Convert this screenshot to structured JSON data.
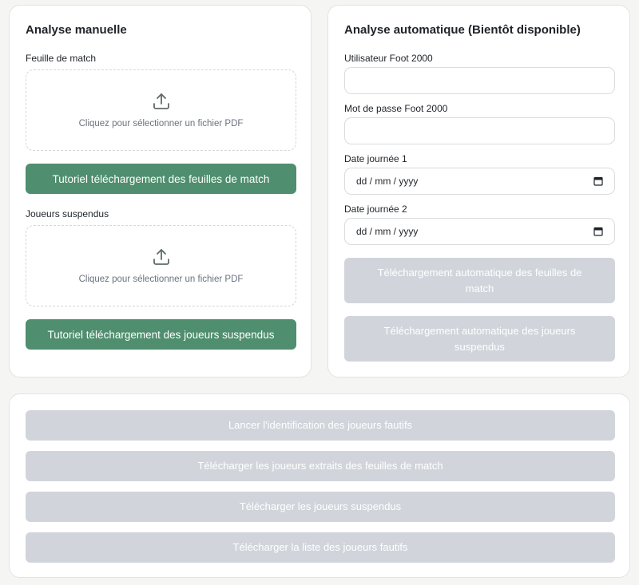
{
  "manual": {
    "title": "Analyse manuelle",
    "match_sheet_label": "Feuille de match",
    "match_sheet_dropzone_text": "Cliquez pour sélectionner un fichier PDF",
    "match_sheet_tutorial_button": "Tutoriel téléchargement des feuilles de match",
    "suspended_label": "Joueurs suspendus",
    "suspended_dropzone_text": "Cliquez pour sélectionner un fichier PDF",
    "suspended_tutorial_button": "Tutoriel téléchargement des joueurs suspendus",
    "icon": "upload-icon"
  },
  "auto": {
    "title": "Analyse automatique (Bientôt disponible)",
    "user_label": "Utilisateur Foot 2000",
    "user_value": "",
    "password_label": "Mot de passe Foot 2000",
    "password_value": "",
    "date1_label": "Date journée 1",
    "date1_placeholder": "dd / mm / yyyy",
    "date2_label": "Date journée 2",
    "date2_placeholder": "dd / mm / yyyy",
    "download_sheets_button": "Téléchargement automatique des feuilles de match",
    "download_suspended_button": "Téléchargement automatique des joueurs suspendus",
    "calendar_icon": "calendar-icon"
  },
  "actions": {
    "identify_button": "Lancer l'identification des joueurs fautifs",
    "download_extracted_button": "Télécharger les joueurs extraits des feuilles de match",
    "download_suspended_button": "Télécharger les joueurs suspendus",
    "download_list_button": "Télécharger la liste des joueurs fautifs"
  },
  "colors": {
    "accent_green": "#4f8e6e",
    "disabled_gray": "#d1d5db",
    "background": "#f5f5f3"
  }
}
